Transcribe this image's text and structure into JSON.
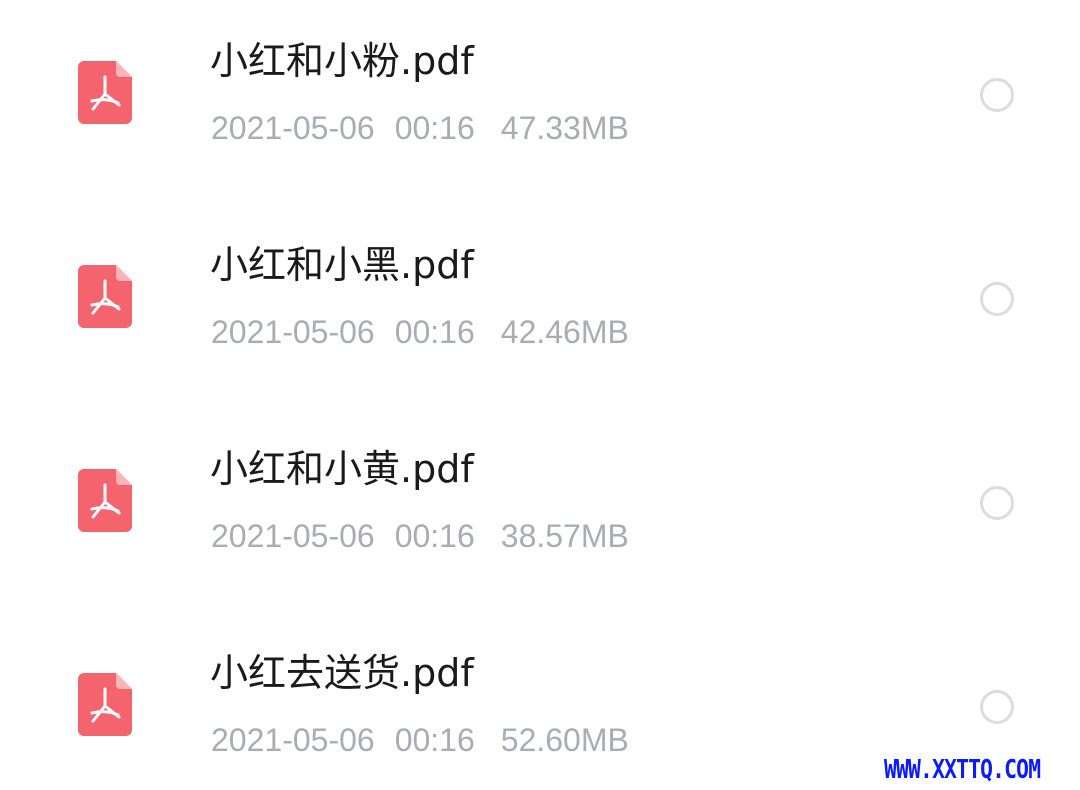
{
  "files": [
    {
      "name": "小红和小粉.pdf",
      "date": "2021-05-06",
      "time": "00:16",
      "size": "47.33MB",
      "icon": "pdf-icon",
      "selected": false
    },
    {
      "name": "小红和小黑.pdf",
      "date": "2021-05-06",
      "time": "00:16",
      "size": "42.46MB",
      "icon": "pdf-icon",
      "selected": false
    },
    {
      "name": "小红和小黄.pdf",
      "date": "2021-05-06",
      "time": "00:16",
      "size": "38.57MB",
      "icon": "pdf-icon",
      "selected": false
    },
    {
      "name": "小红去送货.pdf",
      "date": "2021-05-06",
      "time": "00:16",
      "size": "52.60MB",
      "icon": "pdf-icon",
      "selected": false
    }
  ],
  "watermark": "WWW.XXTTQ.COM",
  "colors": {
    "pdf_icon": "#f4646e",
    "file_name": "#1a1a1a",
    "meta_text": "#a8adb4",
    "radio_border": "#dcdcdc",
    "watermark": "#0a1cff"
  }
}
